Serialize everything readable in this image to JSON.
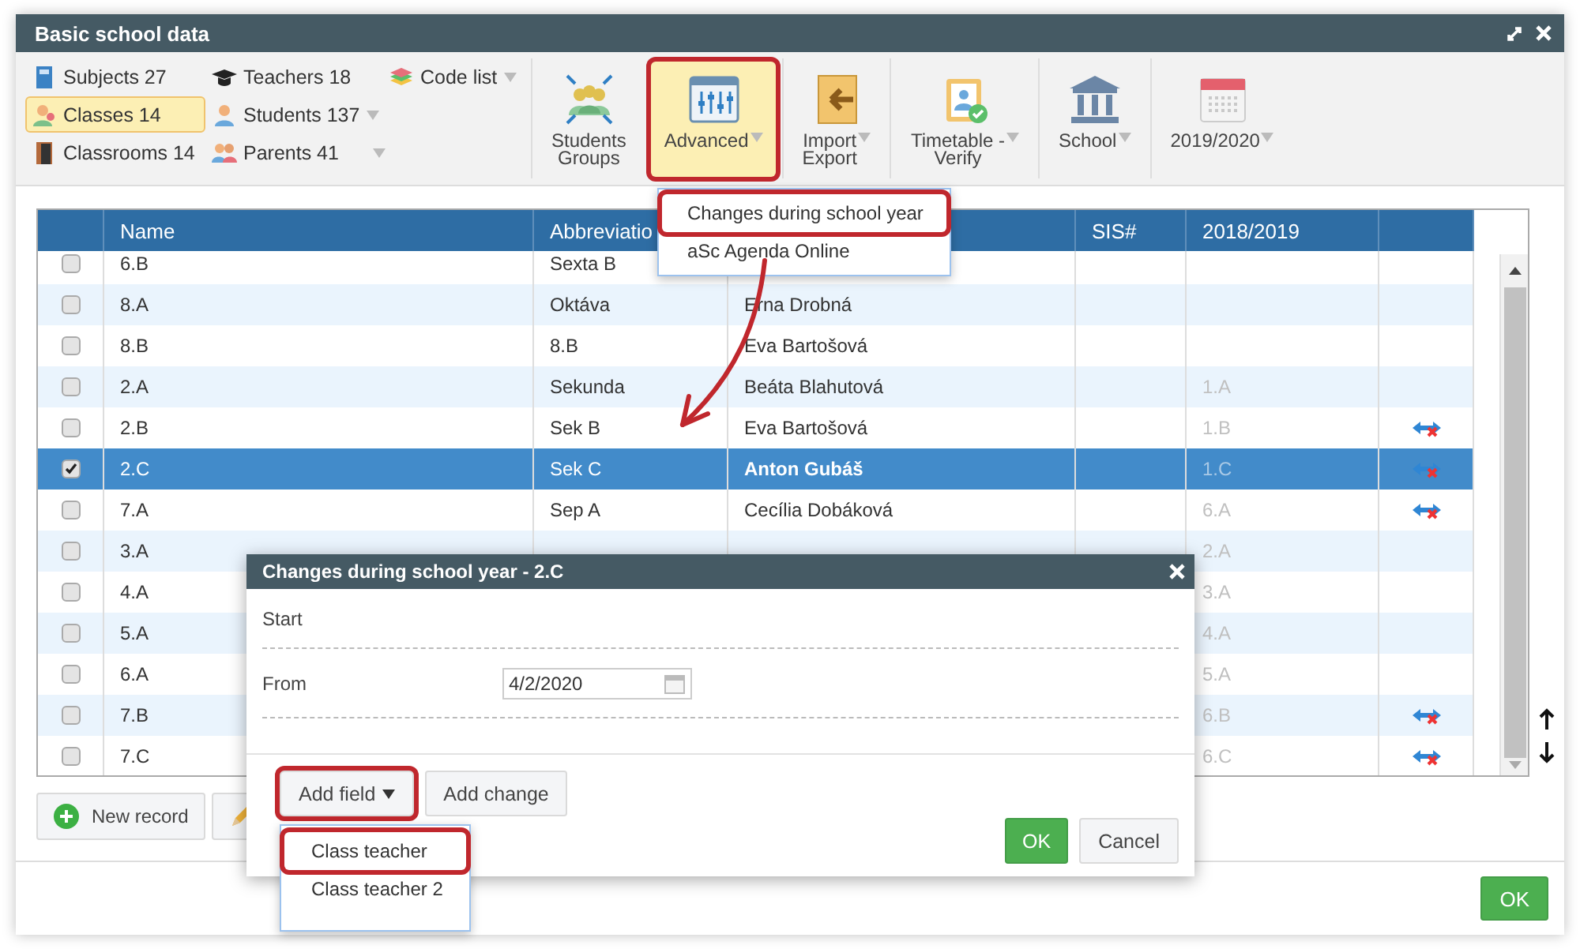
{
  "window": {
    "title": "Basic school data"
  },
  "toolbar": {
    "list_columns": [
      [
        {
          "label": "Subjects 27",
          "selected": false,
          "dropdown": false
        },
        {
          "label": "Classes 14",
          "selected": true,
          "dropdown": false
        },
        {
          "label": "Classrooms 14",
          "selected": false,
          "dropdown": false
        }
      ],
      [
        {
          "label": "Teachers 18",
          "selected": false,
          "dropdown": false
        },
        {
          "label": "Students 137",
          "selected": false,
          "dropdown": true
        },
        {
          "label": "Parents 41",
          "selected": false,
          "dropdown": true
        }
      ],
      [
        {
          "label": "Code list",
          "selected": false,
          "dropdown": true
        }
      ]
    ],
    "buttons": [
      {
        "label": "Students\nGroups",
        "selected": false,
        "dropdown": false,
        "annotated": false
      },
      {
        "label": "Advanced",
        "selected": true,
        "dropdown": true,
        "annotated": true
      },
      {
        "label": "Import\nExport",
        "selected": false,
        "dropdown": true,
        "annotated": false
      },
      {
        "label": "Timetable -\nVerify",
        "selected": false,
        "dropdown": true,
        "annotated": false
      },
      {
        "label": "School",
        "selected": false,
        "dropdown": true,
        "annotated": false
      },
      {
        "label": "2019/2020",
        "selected": false,
        "dropdown": true,
        "annotated": false
      }
    ]
  },
  "advanced_menu": {
    "items": [
      {
        "label": "Changes during school year",
        "annotated": true
      },
      {
        "label": "aSc Agenda Online",
        "annotated": false
      }
    ]
  },
  "table": {
    "columns": {
      "name": "Name",
      "abbreviation": "Abbreviatio",
      "sis": "SIS#",
      "previous": "2018/2019"
    },
    "rows": [
      {
        "name": "6.B",
        "abbreviation": "Sexta B",
        "checked": false,
        "selected": false,
        "linked": false
      },
      {
        "name": "8.A",
        "abbreviation": "Oktáva",
        "teacher": "Erna Drobná",
        "checked": false,
        "selected": false,
        "linked": false
      },
      {
        "name": "8.B",
        "abbreviation": "8.B",
        "teacher": "Eva Bartošová",
        "checked": false,
        "selected": false,
        "linked": false
      },
      {
        "name": "2.A",
        "abbreviation": "Sekunda",
        "teacher": "Beáta Blahutová",
        "previous": "1.A",
        "checked": false,
        "selected": false,
        "linked": false
      },
      {
        "name": "2.B",
        "abbreviation": "Sek B",
        "teacher": "Eva Bartošová",
        "previous": "1.B",
        "checked": false,
        "selected": false,
        "linked": true
      },
      {
        "name": "2.C",
        "abbreviation": "Sek C",
        "teacher": "Anton Gubáš",
        "previous": "1.C",
        "checked": true,
        "selected": true,
        "linked": true
      },
      {
        "name": "7.A",
        "abbreviation": "Sep A",
        "teacher": "Cecília Dobáková",
        "previous": "6.A",
        "checked": false,
        "selected": false,
        "linked": true
      },
      {
        "name": "3.A",
        "previous": "2.A",
        "checked": false,
        "selected": false,
        "linked": false
      },
      {
        "name": "4.A",
        "previous": "3.A",
        "checked": false,
        "selected": false,
        "linked": false
      },
      {
        "name": "5.A",
        "previous": "4.A",
        "checked": false,
        "selected": false,
        "linked": false
      },
      {
        "name": "6.A",
        "previous": "5.A",
        "checked": false,
        "selected": false,
        "linked": false
      },
      {
        "name": "7.B",
        "previous": "6.B",
        "checked": false,
        "selected": false,
        "linked": true
      },
      {
        "name": "7.C",
        "previous": "6.C",
        "checked": false,
        "selected": false,
        "linked": true
      }
    ]
  },
  "bottom_buttons": [
    {
      "label": "New record"
    }
  ],
  "footer": {
    "ok": "OK"
  },
  "dialog": {
    "title": "Changes during school year - 2.C",
    "fields": [
      {
        "kind": "heading",
        "label": "Start"
      },
      {
        "kind": "date",
        "label": "From",
        "value": "4/2/2020"
      }
    ],
    "buttons": [
      {
        "label": "Add field",
        "kind": "dropdown",
        "annotated": true
      },
      {
        "label": "Add change",
        "kind": "plain",
        "annotated": false
      }
    ],
    "actions": [
      {
        "label": "OK",
        "kind": "primary"
      },
      {
        "label": "Cancel",
        "kind": "secondary"
      }
    ],
    "field_menu": {
      "items": [
        {
          "label": "Class teacher",
          "annotated": true
        },
        {
          "label": "Class teacher 2",
          "annotated": false
        }
      ]
    }
  }
}
